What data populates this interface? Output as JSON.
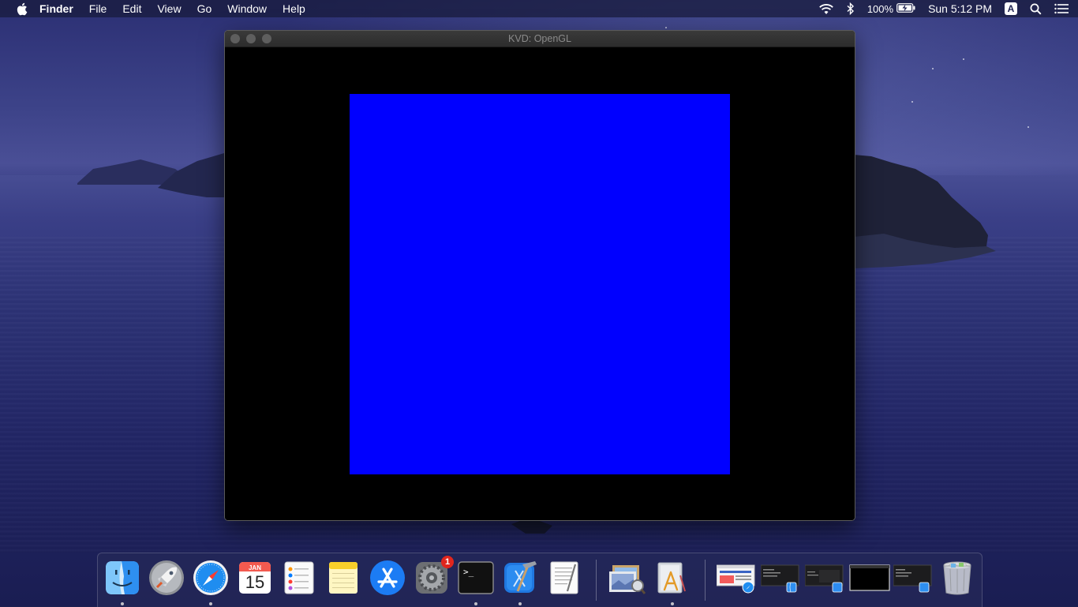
{
  "menubar": {
    "apple_icon": "apple-logo-icon",
    "app_name": "Finder",
    "menus": [
      "File",
      "Edit",
      "View",
      "Go",
      "Window",
      "Help"
    ],
    "battery_text": "100%",
    "clock": "Sun 5:12 PM",
    "input_source": "A",
    "status_icons": [
      "wifi-icon",
      "bluetooth-icon",
      "battery-charging-icon",
      "input-source-icon",
      "spotlight-icon",
      "notification-center-icon"
    ]
  },
  "window": {
    "title": "KVD: OpenGL",
    "background_color": "#000000",
    "render_color": "#0000ff"
  },
  "dock": {
    "apps": [
      {
        "name": "finder",
        "running": true
      },
      {
        "name": "launchpad",
        "running": false
      },
      {
        "name": "safari",
        "running": true
      },
      {
        "name": "calendar",
        "running": false,
        "month": "JAN",
        "day": "15"
      },
      {
        "name": "reminders",
        "running": false
      },
      {
        "name": "notes",
        "running": false
      },
      {
        "name": "app-store",
        "running": false
      },
      {
        "name": "system-preferences",
        "running": false,
        "badge": "1"
      },
      {
        "name": "terminal",
        "running": true,
        "glyph": ">_"
      },
      {
        "name": "xcode",
        "running": true
      },
      {
        "name": "textedit",
        "running": false
      }
    ],
    "stacks": [
      {
        "name": "preview"
      },
      {
        "name": "applications-folder"
      }
    ],
    "minimized": [
      {
        "name": "minimized-safari-window"
      },
      {
        "name": "minimized-finder-window-1"
      },
      {
        "name": "minimized-xcode-window"
      },
      {
        "name": "minimized-terminal-window"
      },
      {
        "name": "minimized-finder-window-2"
      }
    ],
    "trash": {
      "name": "trash"
    }
  }
}
